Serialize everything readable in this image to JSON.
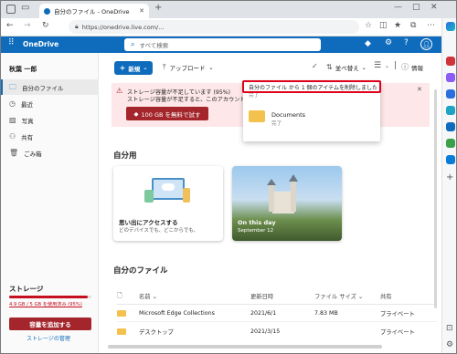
{
  "browser": {
    "tab_title": "自分のファイル - OneDrive",
    "url": "https://onedrive.live.com/..."
  },
  "header": {
    "app_name": "OneDrive",
    "search_placeholder": "すべて検索"
  },
  "nav": {
    "user_name": "秋葉 一郎",
    "items": [
      {
        "label": "自分のファイル",
        "icon": "folder-icon"
      },
      {
        "label": "最近",
        "icon": "clock-icon"
      },
      {
        "label": "写真",
        "icon": "photo-icon"
      },
      {
        "label": "共有",
        "icon": "people-icon"
      },
      {
        "label": "ごみ箱",
        "icon": "trash-icon"
      }
    ],
    "storage_title": "ストレージ",
    "storage_usage": "4.9 GB / 5 GB を使用済み (95%)",
    "storage_used_fraction": 0.95,
    "add_storage": "容量を追加する",
    "manage_storage": "ストレージの管理"
  },
  "toolbar": {
    "new_label": "新規",
    "upload_label": "アップロード",
    "sort_label": "並べ替え",
    "info_label": "情報"
  },
  "banner": {
    "line1": "ストレージ容量が不足しています (95%)",
    "line2": "ストレージ容量が不足すると、このアカウントで新しいファイルの",
    "button": "100 GB を無料で試す"
  },
  "toast": {
    "message": "自分のファイル から 1 個のアイテムを削除しました",
    "sub": "完了",
    "item_name": "Documents",
    "item_status": "完了"
  },
  "for_you": {
    "title": "自分用",
    "card1_title": "思い出にアクセスする",
    "card1_sub": "どのデバイスでも、どこからでも、",
    "card2_title": "On this day",
    "card2_date": "September 12"
  },
  "files": {
    "title": "自分のファイル",
    "columns": [
      "名前",
      "更新日時",
      "ファイル サイズ",
      "共有"
    ],
    "rows": [
      {
        "name": "Microsoft Edge Collections",
        "date": "2021/6/1",
        "size": "7.83 MB",
        "sharing": "プライベート"
      },
      {
        "name": "デスクトップ",
        "date": "2021/3/15",
        "size": "",
        "sharing": "プライベート"
      }
    ]
  }
}
